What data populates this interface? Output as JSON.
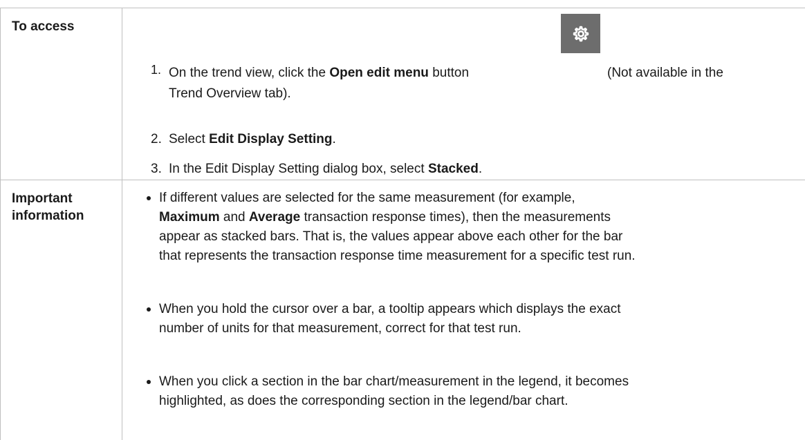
{
  "rows": [
    {
      "label": "To access",
      "steps": [
        {
          "num": "1.",
          "pre": "On the trend view, click the ",
          "bold": "Open edit menu",
          "mid": " button",
          "post": "(Not available in the",
          "line2": "Trend Overview tab)."
        },
        {
          "num": "2.",
          "pre": "Select ",
          "bold": "Edit Display Setting",
          "post": "."
        },
        {
          "num": "3.",
          "pre": "In the Edit Display Setting dialog box, select ",
          "bold": "Stacked",
          "post": "."
        }
      ]
    },
    {
      "label_line1": "Important",
      "label_line2": "information",
      "bullets": [
        {
          "line1": "If different values are selected for the same measurement (for example,",
          "line2_bold1": "Maximum",
          "line2_mid": " and ",
          "line2_bold2": "Average",
          "line2_post": " transaction response times), then the measurements",
          "line3": "appear as stacked bars. That is, the values appear above each other for the bar",
          "line4": "that represents the transaction response time measurement for a specific test run."
        },
        {
          "line1": "When you hold the cursor over a bar, a tooltip appears which displays the exact",
          "line2": "number of units for that measurement, correct for that test run."
        },
        {
          "line1": "When you click a section in the bar chart/measurement in the legend, it becomes",
          "line2": "highlighted, as does the corresponding section in the legend/bar chart."
        }
      ]
    }
  ],
  "icons": {
    "open_edit_menu": "gear-icon"
  },
  "colors": {
    "border": "#bfbfbf",
    "gear_button_bg": "#6d6d6d",
    "text": "#1a1a1a"
  }
}
